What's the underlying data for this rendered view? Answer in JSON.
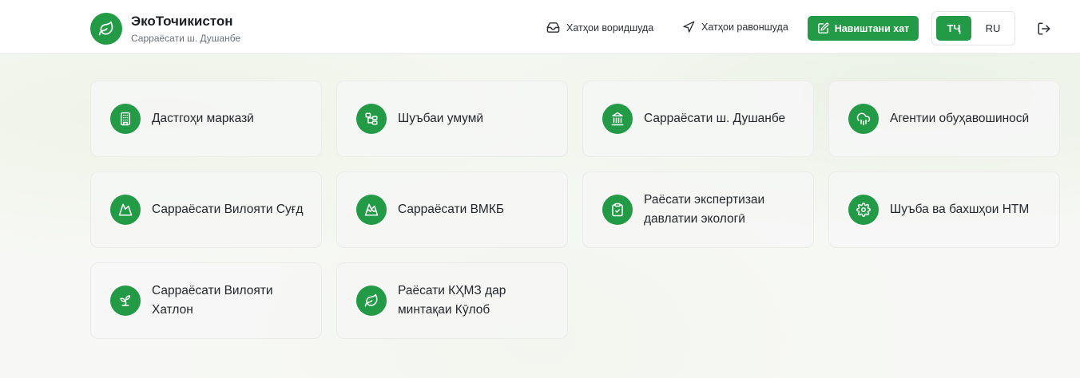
{
  "brand": {
    "title": "ЭкоТочикистон",
    "subtitle": "Сарраёсати ш. Душанбе",
    "logo_icon": "leaf-icon"
  },
  "nav": {
    "inbox_label": "Хатҳои воридшуда",
    "inbox_icon": "inbox-icon",
    "sent_label": "Хатҳои равоншуда",
    "sent_icon": "send-icon",
    "write_label": "Навиштани хат",
    "write_icon": "edit-icon",
    "lang_tj": "ТҶ",
    "lang_ru": "RU",
    "active_lang": "ТҶ",
    "logout_icon": "logout-icon"
  },
  "colors": {
    "accent": "#229a46",
    "card_bg": "#f5f6f5"
  },
  "cards": [
    {
      "label": "Дастгоҳи марказӣ",
      "icon": "building-icon"
    },
    {
      "label": "Шуъбаи умумӣ",
      "icon": "org-chart-icon"
    },
    {
      "label": "Сарраёсати ш. Душанбе",
      "icon": "landmark-icon"
    },
    {
      "label": "Агентии обуҳавошиносӣ",
      "icon": "cloud-rain-icon"
    },
    {
      "label": "Сарраёсати Вилояти Суғд",
      "icon": "mountain-icon"
    },
    {
      "label": "Сарраёсати ВМКБ",
      "icon": "mountain-snow-icon"
    },
    {
      "label": "Раёсати экспертизаи давлатии экологӣ",
      "icon": "clipboard-check-icon"
    },
    {
      "label": "Шуъба ва бахшҳои НТМ",
      "icon": "gear-icon"
    },
    {
      "label": "Сарраёсати Вилояти Хатлон",
      "icon": "sprout-icon"
    },
    {
      "label": "Раёсати КҲМЗ дар минтақаи Кӯлоб",
      "icon": "leaf-icon"
    }
  ]
}
